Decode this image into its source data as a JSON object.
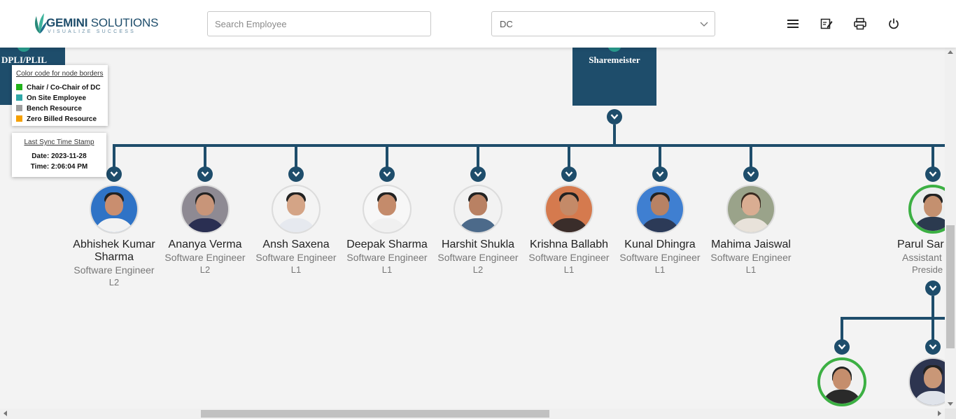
{
  "header": {
    "logo_main_bold": "GEMINI",
    "logo_main_rest": " SOLUTIONS",
    "logo_tagline": "VISUALIZE SUCCESS",
    "search_placeholder": "Search Employee",
    "dc_select_value": "DC",
    "icons": [
      "menu-icon",
      "edit-note-icon",
      "print-icon",
      "power-icon"
    ]
  },
  "org": {
    "department_label": "DPLI/PLIL",
    "root_label": "Sharemeister"
  },
  "legend": {
    "title": "Color code for node borders",
    "items": [
      {
        "label": "Chair / Co-Chair of DC",
        "color": "#21b21a"
      },
      {
        "label": "On Site Employee",
        "color": "#2fa7a7"
      },
      {
        "label": "Bench Resource",
        "color": "#9e9e9e"
      },
      {
        "label": "Zero Billed Resource",
        "color": "#f5a000"
      }
    ]
  },
  "sync": {
    "title": "Last Sync Time Stamp",
    "date_line": "Date: 2023-11-28",
    "time_line": "Time: 2:06:04 PM"
  },
  "employees": [
    {
      "name": "Abhishek Kumar Sharma",
      "role": "Software Engineer",
      "level": "L2"
    },
    {
      "name": "Ananya Verma",
      "role": "Software Engineer",
      "level": "L2"
    },
    {
      "name": "Ansh Saxena",
      "role": "Software Engineer",
      "level": "L1"
    },
    {
      "name": "Deepak Sharma",
      "role": "Software Engineer",
      "level": "L1"
    },
    {
      "name": "Harshit Shukla",
      "role": "Software Engineer",
      "level": "L2"
    },
    {
      "name": "Krishna Ballabh",
      "role": "Software Engineer",
      "level": "L1"
    },
    {
      "name": "Kunal Dhingra",
      "role": "Software Engineer",
      "level": "L1"
    },
    {
      "name": "Mahima Jaiswal",
      "role": "Software Engineer",
      "level": "L1"
    },
    {
      "name": "Parul Sar",
      "role": "Assistant",
      "level": "Preside"
    }
  ],
  "colors": {
    "brand_navy": "#1e4d6b",
    "chair_border": "#3cb043"
  }
}
